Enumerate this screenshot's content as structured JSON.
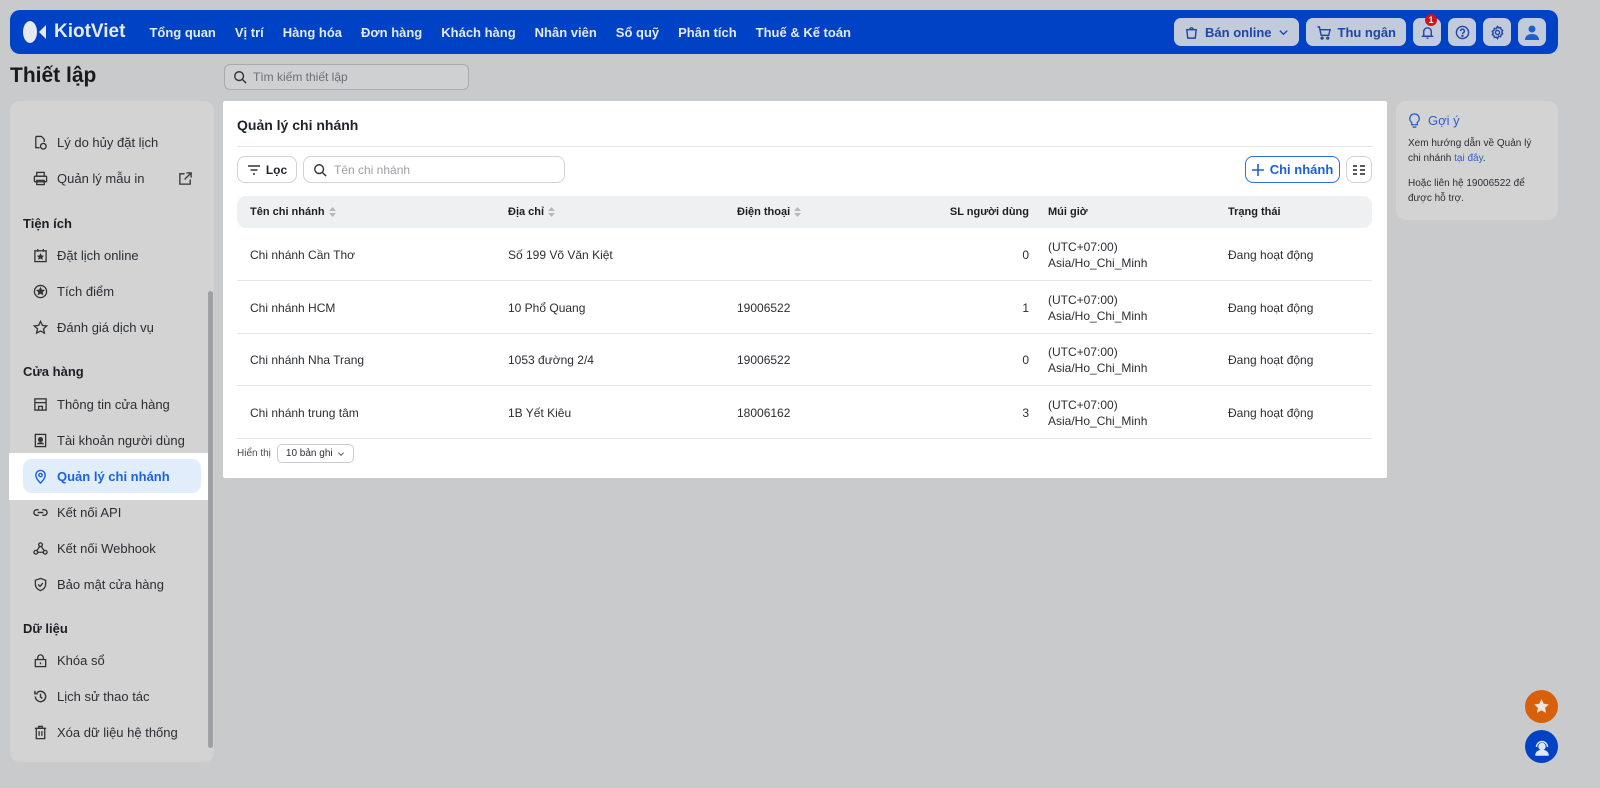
{
  "topbar": {
    "brand": "KiotViet",
    "nav": [
      "Tổng quan",
      "Vị trí",
      "Hàng hóa",
      "Đơn hàng",
      "Khách hàng",
      "Nhân viên",
      "Sổ quỹ",
      "Phân tích",
      "Thuế & Kế toán"
    ],
    "online_label": "Bán online",
    "cashier_label": "Thu ngân",
    "notification_count": "1"
  },
  "page": {
    "title": "Thiết lập",
    "search_placeholder": "Tìm kiếm thiết lập"
  },
  "sidebar": {
    "items_top": [
      "Lý do hủy đặt lịch",
      "Quản lý mẫu in"
    ],
    "utilities": {
      "label": "Tiện ích",
      "items": [
        "Đặt lịch online",
        "Tích điểm",
        "Đánh giá dịch vụ"
      ]
    },
    "store": {
      "label": "Cửa hàng",
      "items": [
        "Thông tin cửa hàng",
        "Tài khoản người dùng",
        "Quản lý chi nhánh",
        "Kết nối API",
        "Kết nối Webhook",
        "Bảo mật cửa hàng"
      ]
    },
    "data": {
      "label": "Dữ liệu",
      "items": [
        "Khóa sổ",
        "Lịch sử thao tác",
        "Xóa dữ liệu hệ thống"
      ]
    }
  },
  "main": {
    "title": "Quản lý chi nhánh",
    "filter_label": "Lọc",
    "search_placeholder": "Tên chi nhánh",
    "add_label": "Chi nhánh",
    "columns": [
      "Tên chi nhánh",
      "Địa chỉ",
      "Điện thoại",
      "SL người dùng",
      "Múi giờ",
      "Trạng thái"
    ],
    "rows": [
      {
        "name": "Chi nhánh Cần Thơ",
        "address": "Số 199 Võ Văn Kiệt",
        "phone": "",
        "users": "0",
        "tz1": "(UTC+07:00)",
        "tz2": "Asia/Ho_Chi_Minh",
        "status": "Đang hoạt động"
      },
      {
        "name": "Chi nhánh HCM",
        "address": "10 Phổ Quang",
        "phone": "19006522",
        "users": "1",
        "tz1": "(UTC+07:00)",
        "tz2": "Asia/Ho_Chi_Minh",
        "status": "Đang hoạt động"
      },
      {
        "name": "Chi nhánh Nha Trang",
        "address": "1053 đường 2/4",
        "phone": "19006522",
        "users": "0",
        "tz1": "(UTC+07:00)",
        "tz2": "Asia/Ho_Chi_Minh",
        "status": "Đang hoạt động"
      },
      {
        "name": "Chi nhánh trung tâm",
        "address": "1B Yết Kiêu",
        "phone": "18006162",
        "users": "3",
        "tz1": "(UTC+07:00)",
        "tz2": "Asia/Ho_Chi_Minh",
        "status": "Đang hoạt động"
      }
    ],
    "show_label": "Hiển thị",
    "page_size": "10 bản ghi"
  },
  "hint": {
    "title": "Gợi ý",
    "text1": "Xem hướng dẫn về Quản lý chi nhánh ",
    "link": "tại đây",
    "text1_end": ".",
    "text2": "Hoặc liên hệ 19006522 để được hỗ trợ."
  },
  "colors": {
    "brand": "#0042c6",
    "accent": "#1a63e0",
    "favorite": "#d9600a"
  }
}
